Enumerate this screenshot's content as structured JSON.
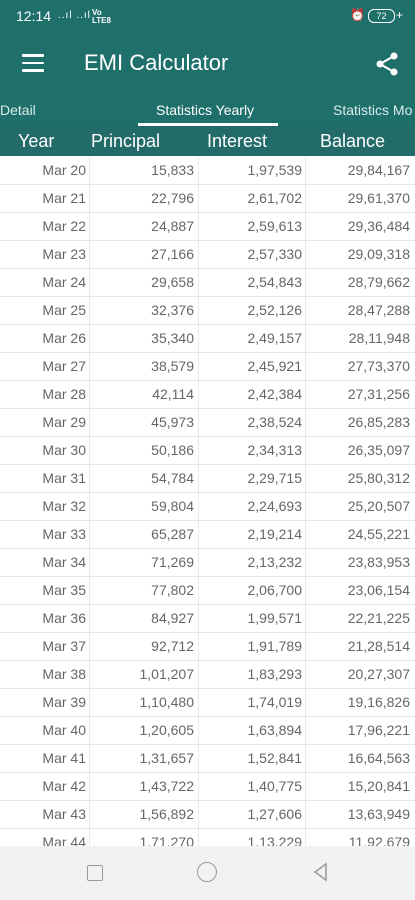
{
  "status": {
    "time": "12:14",
    "signal": "..ıl ..ıl",
    "volte_top": "Vo",
    "volte_bottom": "LTE8",
    "battery": "72",
    "plus": "+"
  },
  "app": {
    "title": "EMI Calculator"
  },
  "tabs": [
    {
      "label": "Detail"
    },
    {
      "label": "Statistics Yearly"
    },
    {
      "label": "Statistics Mo"
    }
  ],
  "table": {
    "headers": [
      "Year",
      "Principal",
      "Interest",
      "Balance"
    ],
    "rows": [
      [
        "Mar 20",
        "15,833",
        "1,97,539",
        "29,84,167"
      ],
      [
        "Mar 21",
        "22,796",
        "2,61,702",
        "29,61,370"
      ],
      [
        "Mar 22",
        "24,887",
        "2,59,613",
        "29,36,484"
      ],
      [
        "Mar 23",
        "27,166",
        "2,57,330",
        "29,09,318"
      ],
      [
        "Mar 24",
        "29,658",
        "2,54,843",
        "28,79,662"
      ],
      [
        "Mar 25",
        "32,376",
        "2,52,126",
        "28,47,288"
      ],
      [
        "Mar 26",
        "35,340",
        "2,49,157",
        "28,11,948"
      ],
      [
        "Mar 27",
        "38,579",
        "2,45,921",
        "27,73,370"
      ],
      [
        "Mar 28",
        "42,114",
        "2,42,384",
        "27,31,256"
      ],
      [
        "Mar 29",
        "45,973",
        "2,38,524",
        "26,85,283"
      ],
      [
        "Mar 30",
        "50,186",
        "2,34,313",
        "26,35,097"
      ],
      [
        "Mar 31",
        "54,784",
        "2,29,715",
        "25,80,312"
      ],
      [
        "Mar 32",
        "59,804",
        "2,24,693",
        "25,20,507"
      ],
      [
        "Mar 33",
        "65,287",
        "2,19,214",
        "24,55,221"
      ],
      [
        "Mar 34",
        "71,269",
        "2,13,232",
        "23,83,953"
      ],
      [
        "Mar 35",
        "77,802",
        "2,06,700",
        "23,06,154"
      ],
      [
        "Mar 36",
        "84,927",
        "1,99,571",
        "22,21,225"
      ],
      [
        "Mar 37",
        "92,712",
        "1,91,789",
        "21,28,514"
      ],
      [
        "Mar 38",
        "1,01,207",
        "1,83,293",
        "20,27,307"
      ],
      [
        "Mar 39",
        "1,10,480",
        "1,74,019",
        "19,16,826"
      ],
      [
        "Mar 40",
        "1,20,605",
        "1,63,894",
        "17,96,221"
      ],
      [
        "Mar 41",
        "1,31,657",
        "1,52,841",
        "16,64,563"
      ],
      [
        "Mar 42",
        "1,43,722",
        "1,40,775",
        "15,20,841"
      ],
      [
        "Mar 43",
        "1,56,892",
        "1,27,606",
        "13,63,949"
      ],
      [
        "Mar 44",
        "1,71,270",
        "1,13,229",
        "11,92,679"
      ]
    ]
  },
  "icons": {
    "menu": "menu-icon",
    "share": "share-icon",
    "home": "home-circle-icon",
    "recents": "recents-square-icon",
    "back": "back-triangle-icon"
  },
  "colors": {
    "primary": "#1f6f6b",
    "header": "#226b69",
    "nav": "#f2f2f2"
  }
}
